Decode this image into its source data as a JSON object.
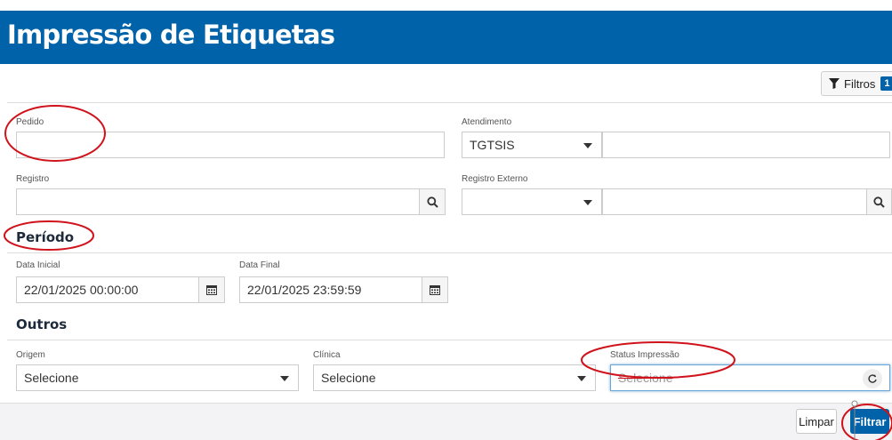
{
  "header": {
    "title": "Impressão de Etiquetas"
  },
  "filters": {
    "label": "Filtros",
    "count": "1"
  },
  "form": {
    "pedido": {
      "label": "Pedido",
      "value": ""
    },
    "atendimento": {
      "label": "Atendimento",
      "select_value": "TGTSIS",
      "value": ""
    },
    "registro": {
      "label": "Registro",
      "value": ""
    },
    "registro_externo": {
      "label": "Registro Externo",
      "select_value": "",
      "value": ""
    }
  },
  "periodo": {
    "title": "Período",
    "data_inicial": {
      "label": "Data Inicial",
      "value": "22/01/2025 00:00:00"
    },
    "data_final": {
      "label": "Data Final",
      "value": "22/01/2025 23:59:59"
    }
  },
  "outros": {
    "title": "Outros",
    "origem": {
      "label": "Origem",
      "value": "Selecione"
    },
    "clinica": {
      "label": "Clínica",
      "value": "Selecione"
    },
    "status_impressao": {
      "label": "Status Impressão",
      "placeholder": "Selecione"
    }
  },
  "actions": {
    "limpar": "Limpar",
    "filtrar": "Filtrar"
  },
  "colors": {
    "brand": "#0062a8",
    "annotation": "#d0121b"
  },
  "icons": [
    "funnel-icon",
    "search-icon",
    "calendar-icon",
    "caret-down-icon",
    "refresh-icon"
  ]
}
